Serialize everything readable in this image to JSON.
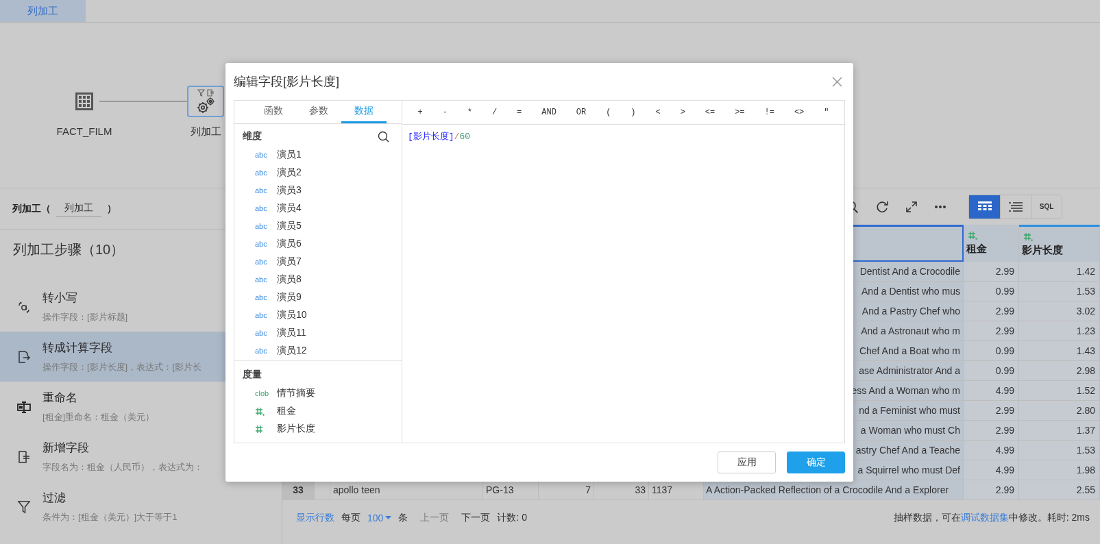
{
  "tab_bar": {
    "tabs": [
      {
        "label": "列加工",
        "selected": true
      }
    ]
  },
  "flow": {
    "nodes": [
      {
        "label": "FACT_FILM",
        "kind": "table",
        "selected": false
      },
      {
        "label": "列加工",
        "kind": "transform",
        "selected": true
      }
    ]
  },
  "step_panel": {
    "prefix": "列加工（",
    "name_field": "列加工",
    "suffix": "）",
    "title": "列加工步骤（10）",
    "steps": [
      {
        "kind": "lowercase",
        "title": "转小写",
        "detail": "操作字段：[影片标题]",
        "selected": false
      },
      {
        "kind": "calc",
        "title": "转成计算字段",
        "detail": "操作字段：[影片长度]，表达式：[影片长",
        "selected": true
      },
      {
        "kind": "rename",
        "title": "重命名",
        "detail": "[租金]重命名：租金（美元）",
        "selected": false
      },
      {
        "kind": "add",
        "title": "新增字段",
        "detail": "字段名为：租金（人民币），表达式为：",
        "selected": false
      },
      {
        "kind": "filter",
        "title": "过滤",
        "detail": "条件为：[租金（美元）]大于等于1",
        "selected": false
      }
    ]
  },
  "view_modes": [
    {
      "kind": "grid",
      "selected": true
    },
    {
      "kind": "list",
      "selected": false
    },
    {
      "kind": "sql",
      "label": "SQL",
      "selected": false
    }
  ],
  "table": {
    "columns": [
      {
        "kind": "description",
        "selected": true
      },
      {
        "kind": "decimal",
        "label": "租金",
        "selected": false,
        "highlighted": false
      },
      {
        "kind": "decimal",
        "label": "影片长度",
        "selected": false,
        "highlighted": true
      }
    ],
    "rows": [
      {
        "description": "Dentist And a Crocodile",
        "rent": "2.99",
        "length": "1.42"
      },
      {
        "description": "And a Dentist who mus",
        "rent": "0.99",
        "length": "1.53"
      },
      {
        "description": "And a Pastry Chef who",
        "rent": "2.99",
        "length": "3.02"
      },
      {
        "description": "And a Astronaut who m",
        "rent": "2.99",
        "length": "1.23"
      },
      {
        "description": "Chef And a Boat who m",
        "rent": "0.99",
        "length": "1.43"
      },
      {
        "description": "ase Administrator And a",
        "rent": "0.99",
        "length": "2.98"
      },
      {
        "description": "ess And a Woman who m",
        "rent": "4.99",
        "length": "1.52"
      },
      {
        "description": "nd a Feminist who must",
        "rent": "2.99",
        "length": "2.80"
      },
      {
        "description": "a Woman who must Ch",
        "rent": "2.99",
        "length": "1.37"
      },
      {
        "description": "astry Chef And a Teache",
        "rent": "4.99",
        "length": "1.53"
      },
      {
        "description": "a Squirrel who must Def",
        "rent": "4.99",
        "length": "1.98"
      },
      {
        "number": "33",
        "title": "apollo teen",
        "rating": "PG-13",
        "column_5": "7",
        "column_6": "33",
        "column_7": "1137",
        "description": "A Action-Packed Reflection of a Crocodile And a Explorer",
        "rent": "2.99",
        "length": "2.55"
      }
    ]
  },
  "footer": {
    "rows_link": "显示行数",
    "per_page_label": "每页",
    "page_size": "100",
    "unit": "条",
    "prev": {
      "label": "上一页",
      "disabled": true
    },
    "next": {
      "label": "下一页",
      "disabled": false
    },
    "count": "计数: 0",
    "note_before": "抽样数据，可在",
    "note_link": "调试数据集",
    "note_after": "中修改。耗时: 2ms"
  },
  "dialog": {
    "title": "编辑字段[影片长度]",
    "tabs": [
      {
        "label": "函数",
        "selected": false
      },
      {
        "label": "参数",
        "selected": false
      },
      {
        "label": "数据",
        "selected": true
      }
    ],
    "dimensions": {
      "title": "维度",
      "fields": [
        {
          "kind": "text",
          "type_label": "abc",
          "name": "演员1"
        },
        {
          "kind": "text",
          "type_label": "abc",
          "name": "演员2"
        },
        {
          "kind": "text",
          "type_label": "abc",
          "name": "演员3"
        },
        {
          "kind": "text",
          "type_label": "abc",
          "name": "演员4"
        },
        {
          "kind": "text",
          "type_label": "abc",
          "name": "演员5"
        },
        {
          "kind": "text",
          "type_label": "abc",
          "name": "演员6"
        },
        {
          "kind": "text",
          "type_label": "abc",
          "name": "演员7"
        },
        {
          "kind": "text",
          "type_label": "abc",
          "name": "演员8"
        },
        {
          "kind": "text",
          "type_label": "abc",
          "name": "演员9"
        },
        {
          "kind": "text",
          "type_label": "abc",
          "name": "演员10"
        },
        {
          "kind": "text",
          "type_label": "abc",
          "name": "演员11"
        },
        {
          "kind": "text",
          "type_label": "abc",
          "name": "演员12"
        }
      ]
    },
    "measures": {
      "title": "度量",
      "fields": [
        {
          "kind": "clob",
          "type_label": "clob",
          "name": "情节摘要"
        },
        {
          "kind": "decimal",
          "name": "租金"
        },
        {
          "kind": "integer",
          "name": "影片长度"
        }
      ]
    },
    "operators": [
      "+",
      "-",
      "*",
      "/",
      "=",
      "AND",
      "OR",
      "(",
      ")",
      "<",
      ">",
      "<=",
      ">=",
      "!=",
      "<>",
      "\""
    ],
    "expression": [
      {
        "kind": "field",
        "text": "[影片长度]"
      },
      {
        "kind": "operator",
        "text": "/"
      },
      {
        "kind": "number",
        "text": "60"
      }
    ],
    "buttons": [
      {
        "kind": "secondary",
        "label": "应用"
      },
      {
        "kind": "primary",
        "label": "确定"
      }
    ]
  }
}
